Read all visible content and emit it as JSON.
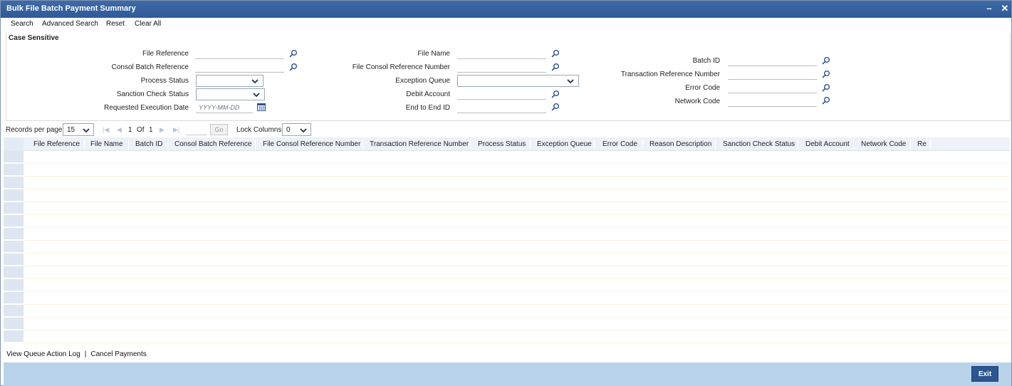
{
  "window": {
    "title": "Bulk File Batch Payment Summary",
    "minimize_label": "–",
    "close_label": "✕"
  },
  "toolbar": {
    "search": "Search",
    "advanced_search": "Advanced Search",
    "reset": "Reset",
    "clear_all": "Clear All"
  },
  "criteria": {
    "section_title": "Case Sensitive",
    "file_reference": {
      "label": "File Reference",
      "value": ""
    },
    "consol_batch_reference": {
      "label": "Consol Batch Reference",
      "value": ""
    },
    "process_status": {
      "label": "Process Status",
      "value": ""
    },
    "sanction_check_status": {
      "label": "Sanction Check Status",
      "value": ""
    },
    "requested_execution_date": {
      "label": "Requested Execution Date",
      "placeholder": "YYYY-MM-DD"
    },
    "file_name": {
      "label": "File Name",
      "value": ""
    },
    "file_consol_reference_number": {
      "label": "File Consol Reference Number",
      "value": ""
    },
    "exception_queue": {
      "label": "Exception Queue",
      "value": ""
    },
    "debit_account": {
      "label": "Debit Account",
      "value": ""
    },
    "end_to_end_id": {
      "label": "End to End ID",
      "value": ""
    },
    "batch_id": {
      "label": "Batch ID",
      "value": ""
    },
    "transaction_reference_number": {
      "label": "Transaction Reference Number",
      "value": ""
    },
    "error_code": {
      "label": "Error Code",
      "value": ""
    },
    "network_code": {
      "label": "Network Code",
      "value": ""
    }
  },
  "pager": {
    "records_per_page_label": "Records per page",
    "records_per_page_value": "15",
    "current_page": "1",
    "of_label": "Of",
    "total_pages": "1",
    "go_label": "Go",
    "lock_columns_label": "Lock Columns",
    "lock_columns_value": "0"
  },
  "grid": {
    "columns": [
      "File Reference",
      "File Name",
      "Batch ID",
      "Consol Batch Reference",
      "File Consol Reference Number",
      "Transaction Reference Number",
      "Process Status",
      "Exception Queue",
      "Error Code",
      "Reason Description",
      "Sanction Check Status",
      "Debit Account",
      "Network Code",
      "Re"
    ],
    "row_count": 15
  },
  "footer": {
    "view_queue_action_log": "View Queue Action Log",
    "separator": "|",
    "cancel_payments": "Cancel Payments",
    "exit": "Exit"
  },
  "icons": {
    "lookup": "magnifier-icon",
    "calendar": "calendar-icon",
    "dropdown": "chevron-down-icon"
  },
  "colors": {
    "title_bar": "#2f5a98",
    "grid_header": "#edf2f8",
    "bottom_bar": "#b9d4ea",
    "exit_button": "#2d5590"
  }
}
